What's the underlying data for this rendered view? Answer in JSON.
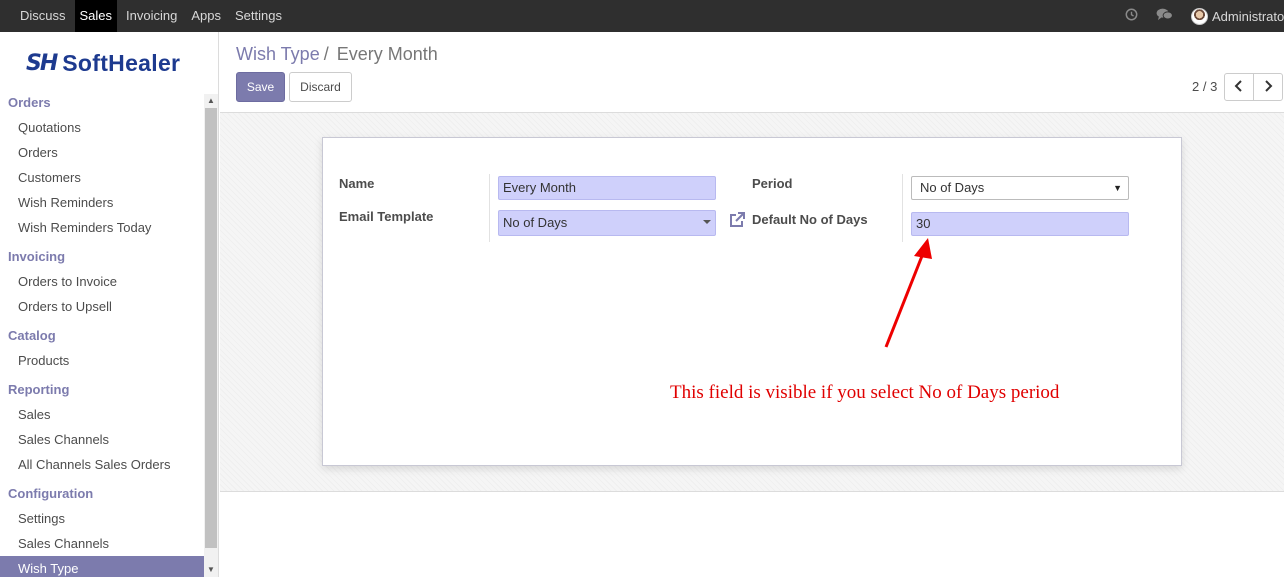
{
  "navbar": {
    "menu": [
      {
        "label": "Discuss",
        "active": false
      },
      {
        "label": "Sales",
        "active": true
      },
      {
        "label": "Invoicing",
        "active": false
      },
      {
        "label": "Apps",
        "active": false
      },
      {
        "label": "Settings",
        "active": false
      }
    ],
    "icons": [
      "clock-icon",
      "chat-icon"
    ],
    "user": "Administrator"
  },
  "logo": {
    "mark": "SH",
    "text": "SoftHealer",
    "color": "#1d3a8f"
  },
  "sidebar": {
    "sections": [
      {
        "title": "Orders",
        "items": [
          "Quotations",
          "Orders",
          "Customers",
          "Wish Reminders",
          "Wish Reminders Today"
        ]
      },
      {
        "title": "Invoicing",
        "items": [
          "Orders to Invoice",
          "Orders to Upsell"
        ]
      },
      {
        "title": "Catalog",
        "items": [
          "Products"
        ]
      },
      {
        "title": "Reporting",
        "items": [
          "Sales",
          "Sales Channels",
          "All Channels Sales Orders"
        ]
      },
      {
        "title": "Configuration",
        "items": [
          "Settings",
          "Sales Channels",
          "Wish Type"
        ]
      }
    ],
    "active_item": "Wish Type"
  },
  "control": {
    "breadcrumb": {
      "parent": "Wish Type",
      "separator": "/",
      "current": "Every Month"
    },
    "save_label": "Save",
    "discard_label": "Discard",
    "pager": "2 / 3",
    "prev_icon": "chevron-left-icon",
    "next_icon": "chevron-right-icon"
  },
  "form": {
    "name_label": "Name",
    "name_value": "Every Month",
    "email_template_label": "Email Template",
    "email_template_value": "No of Days",
    "period_label": "Period",
    "period_value": "No of Days",
    "default_days_label": "Default No of Days",
    "default_days_value": "30"
  },
  "annotation": {
    "text": "This field is visible if you select No of Days period",
    "color": "#e00000"
  },
  "colors": {
    "accent": "#7c7bad",
    "navbar": "#2f2f2f",
    "field_bg": "#cfd0fb"
  }
}
